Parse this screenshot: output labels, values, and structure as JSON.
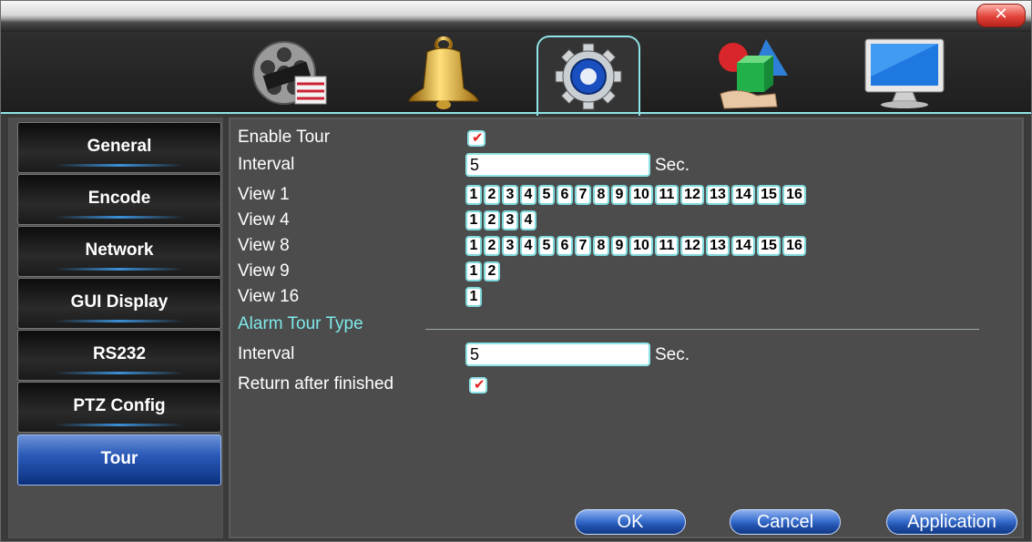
{
  "window": {
    "close_label": "✕"
  },
  "top_tabs": [
    {
      "name": "record",
      "icon": "film-reel-icon"
    },
    {
      "name": "alarm",
      "icon": "bell-icon"
    },
    {
      "name": "system",
      "icon": "gear-icon",
      "active": true
    },
    {
      "name": "advanced",
      "icon": "shapes-icon"
    },
    {
      "name": "info",
      "icon": "monitor-icon"
    }
  ],
  "sidebar": {
    "items": [
      {
        "label": "General"
      },
      {
        "label": "Encode"
      },
      {
        "label": "Network"
      },
      {
        "label": "GUI Display"
      },
      {
        "label": "RS232"
      },
      {
        "label": "PTZ Config"
      },
      {
        "label": "Tour",
        "active": true
      }
    ]
  },
  "form": {
    "enable_tour_label": "Enable Tour",
    "enable_tour_checked": true,
    "check_mark": "✔",
    "interval_label": "Interval",
    "interval_value": "5",
    "unit": "Sec.",
    "views": [
      {
        "label": "View 1",
        "buttons": [
          "1",
          "2",
          "3",
          "4",
          "5",
          "6",
          "7",
          "8",
          "9",
          "10",
          "11",
          "12",
          "13",
          "14",
          "15",
          "16"
        ]
      },
      {
        "label": "View 4",
        "buttons": [
          "1",
          "2",
          "3",
          "4"
        ]
      },
      {
        "label": "View 8",
        "buttons": [
          "1",
          "2",
          "3",
          "4",
          "5",
          "6",
          "7",
          "8",
          "9",
          "10",
          "11",
          "12",
          "13",
          "14",
          "15",
          "16"
        ]
      },
      {
        "label": "View 9",
        "buttons": [
          "1",
          "2"
        ]
      },
      {
        "label": "View 16",
        "buttons": [
          "1"
        ]
      }
    ],
    "alarm_section_label": "Alarm Tour Type",
    "alarm_interval_label": "Interval",
    "alarm_interval_value": "5",
    "alarm_unit": "Sec.",
    "return_label": "Return after finished",
    "return_checked": true
  },
  "buttons": {
    "ok": "OK",
    "cancel": "Cancel",
    "apply": "Application"
  }
}
